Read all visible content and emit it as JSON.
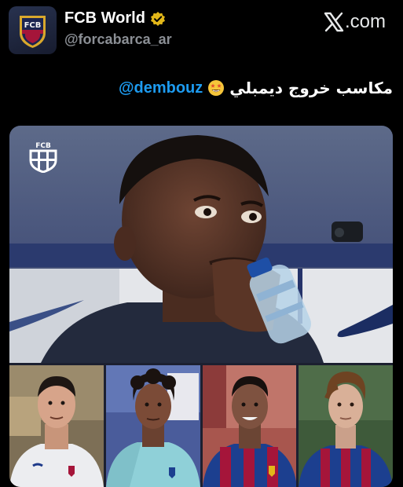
{
  "account": {
    "display_name": "FCB World",
    "handle": "@forcabarca_ar",
    "avatar_text": "FCB",
    "verified": true
  },
  "source": {
    "site": ".com",
    "icon": "x-logo-icon"
  },
  "tweet": {
    "text": "مكاسب خروج ديمبلي",
    "emoji": "star-struck-emoji",
    "mention": "@dembouz"
  },
  "media": {
    "watermark_text": "FCB",
    "colors": {
      "accent": "#1d9bf0",
      "barca_blue": "#1c3f8f",
      "barca_red": "#a5153a",
      "verified_gold": "#e2b719"
    }
  }
}
